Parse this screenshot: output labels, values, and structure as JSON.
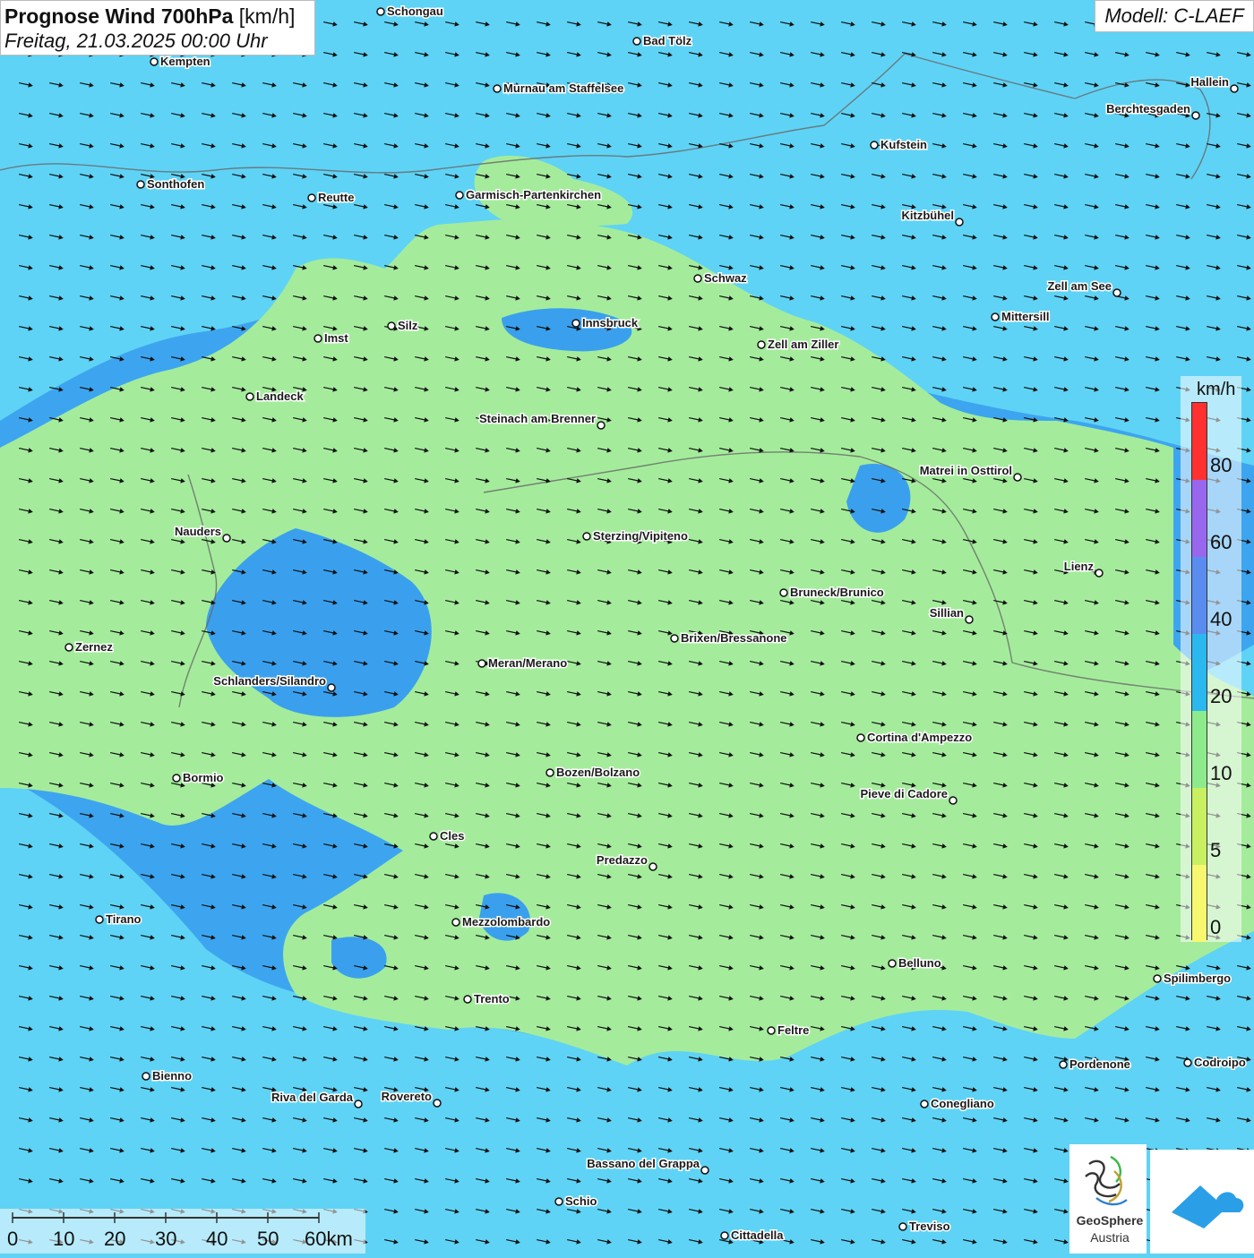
{
  "title": {
    "main_bold": "Prognose Wind 700hPa",
    "main_unit": " [km/h]",
    "subtitle": "Freitag, 21.03.2025 00:00 Uhr"
  },
  "model": "Modell: C-LAEF",
  "legend": {
    "unit": "km/h",
    "labels": [
      "80",
      "60",
      "40",
      "20",
      "10",
      "5",
      "0"
    ],
    "segments": [
      {
        "color": "#ff3030"
      },
      {
        "color": "#9966ee"
      },
      {
        "color": "#5a8cf0"
      },
      {
        "color": "#2ab8ee"
      },
      {
        "color": "#8deb8c"
      },
      {
        "color": "#c8f060"
      },
      {
        "color": "#f8f870"
      }
    ]
  },
  "scale": {
    "labels": [
      "0",
      "10",
      "20",
      "30",
      "40",
      "50",
      "60km"
    ]
  },
  "logos": {
    "geosphere_line1": "GeoSphere",
    "geosphere_line2": "Austria"
  },
  "colors": {
    "fast_wind": "#5fd3f5",
    "medium_wind": "#3aa0ee",
    "slow_wind": "#a4ec9c"
  },
  "wind": {
    "direction": "east-southeast"
  },
  "cities": [
    {
      "name": "Schongau",
      "side": "r"
    },
    {
      "name": "Bad Tölz",
      "side": "r"
    },
    {
      "name": "Kempten",
      "side": "r"
    },
    {
      "name": "Murnau am Staffelsee",
      "side": "r"
    },
    {
      "name": "Hallein",
      "side": "l"
    },
    {
      "name": "Berchtesgaden",
      "side": "l"
    },
    {
      "name": "Kufstein",
      "side": "r"
    },
    {
      "name": "Sonthofen",
      "side": "r"
    },
    {
      "name": "Reutte",
      "side": "r"
    },
    {
      "name": "Garmisch-Partenkirchen",
      "side": "r"
    },
    {
      "name": "Kitzbühel",
      "side": "l"
    },
    {
      "name": "Schwaz",
      "side": "r"
    },
    {
      "name": "Zell am See",
      "side": "l"
    },
    {
      "name": "Innsbruck",
      "side": "r"
    },
    {
      "name": "Mittersill",
      "side": "r"
    },
    {
      "name": "Silz",
      "side": "r"
    },
    {
      "name": "Imst",
      "side": "r"
    },
    {
      "name": "Zell am Ziller",
      "side": "r"
    },
    {
      "name": "Landeck",
      "side": "r"
    },
    {
      "name": "Steinach am Brenner",
      "side": "l"
    },
    {
      "name": "Matrei in Osttirol",
      "side": "l"
    },
    {
      "name": "Nauders",
      "side": "l"
    },
    {
      "name": "Sterzing/Vipiteno",
      "side": "r"
    },
    {
      "name": "Lienz",
      "side": "l"
    },
    {
      "name": "Bruneck/Brunico",
      "side": "r"
    },
    {
      "name": "Sillian",
      "side": "l"
    },
    {
      "name": "Zernez",
      "side": "r"
    },
    {
      "name": "Brixen/Bressanone",
      "side": "r"
    },
    {
      "name": "Meran/Merano",
      "side": "r"
    },
    {
      "name": "Schlanders/Silandro",
      "side": "l"
    },
    {
      "name": "Cortina d'Ampezzo",
      "side": "r"
    },
    {
      "name": "Bozen/Bolzano",
      "side": "r"
    },
    {
      "name": "Bormio",
      "side": "r"
    },
    {
      "name": "Pieve di Cadore",
      "side": "l"
    },
    {
      "name": "Cles",
      "side": "r"
    },
    {
      "name": "Predazzo",
      "side": "l"
    },
    {
      "name": "Tirano",
      "side": "r"
    },
    {
      "name": "Mezzolombardo",
      "side": "r"
    },
    {
      "name": "Belluno",
      "side": "r"
    },
    {
      "name": "Spilimbergo",
      "side": "r"
    },
    {
      "name": "Trento",
      "side": "r"
    },
    {
      "name": "Feltre",
      "side": "r"
    },
    {
      "name": "Pordenone",
      "side": "r"
    },
    {
      "name": "Codroipo",
      "side": "r"
    },
    {
      "name": "Bienno",
      "side": "r"
    },
    {
      "name": "Riva del Garda",
      "side": "l"
    },
    {
      "name": "Rovereto",
      "side": "l"
    },
    {
      "name": "Conegliano",
      "side": "r"
    },
    {
      "name": "Bassano del Grappa",
      "side": "l"
    },
    {
      "name": "Schio",
      "side": "r"
    },
    {
      "name": "Treviso",
      "side": "r"
    },
    {
      "name": "Cittadella",
      "side": "r"
    }
  ]
}
